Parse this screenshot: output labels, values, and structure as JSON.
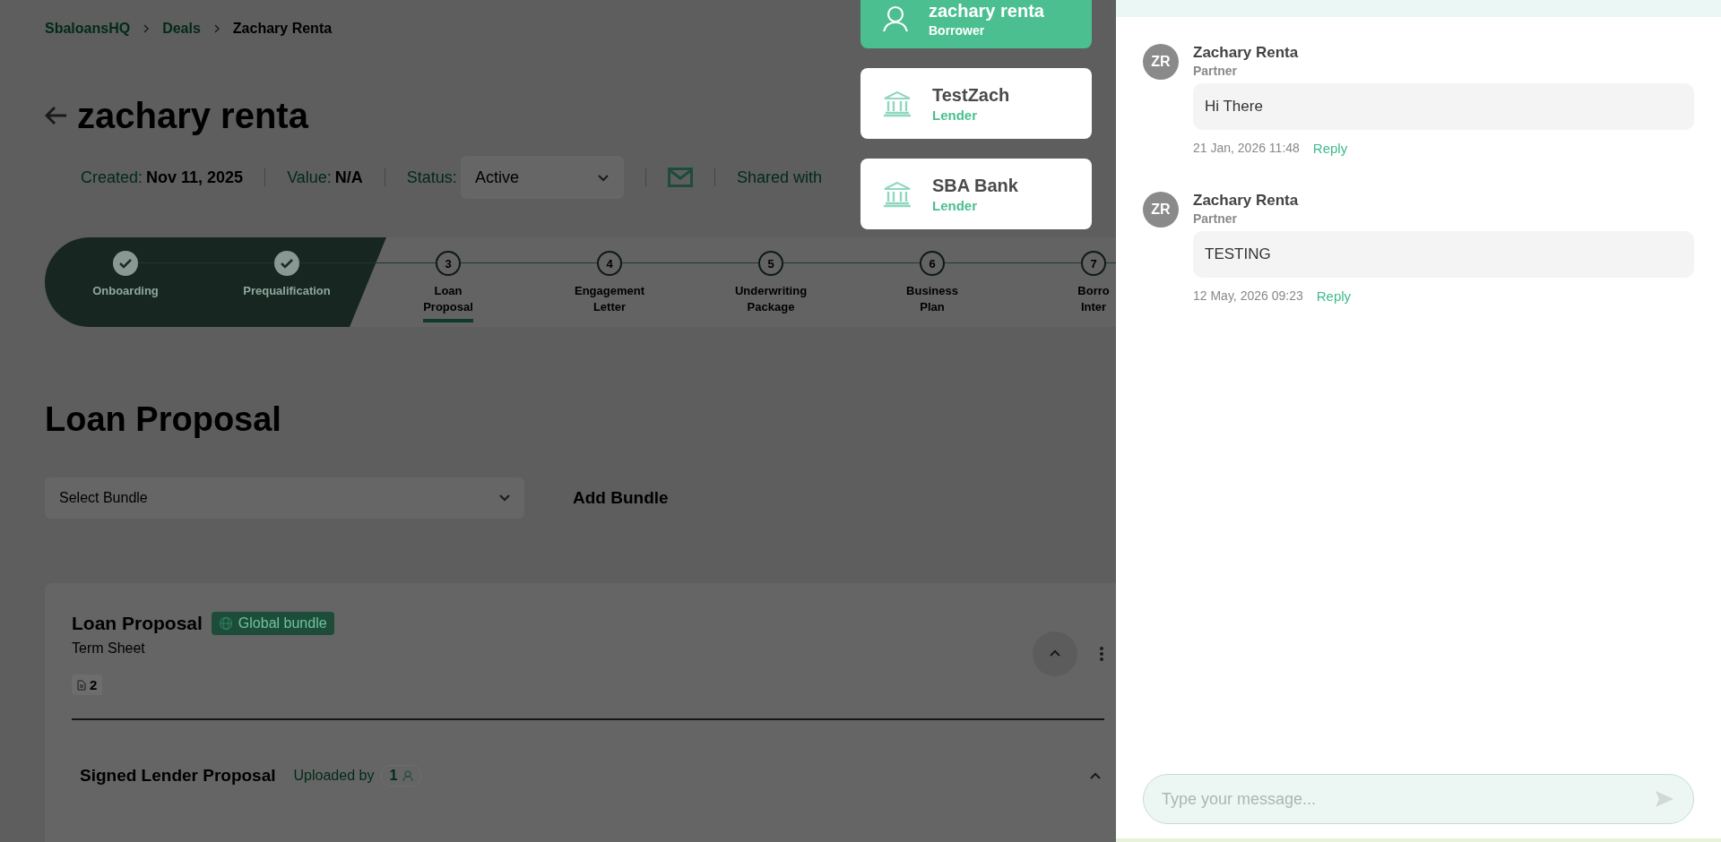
{
  "breadcrumbs": [
    {
      "label": "SbaloansHQ",
      "current": false
    },
    {
      "label": "Deals",
      "current": false
    },
    {
      "label": "Zachary Renta",
      "current": true
    }
  ],
  "deal": {
    "title": "zachary renta",
    "created_label": "Created:",
    "created": "Nov 11, 2025",
    "value_label": "Value:",
    "value": "N/A",
    "status_label": "Status:",
    "status": "Active",
    "shared_label": "Shared with"
  },
  "steps": [
    {
      "label": "Onboarding",
      "completed": true,
      "selected": false
    },
    {
      "label": "Prequalification",
      "completed": true,
      "selected": false
    },
    {
      "number": "3",
      "label": "Loan Proposal",
      "completed": false,
      "selected": true
    },
    {
      "number": "4",
      "label": "Engagement Letter",
      "completed": false,
      "selected": false
    },
    {
      "number": "5",
      "label": "Underwriting Package",
      "completed": false,
      "selected": false
    },
    {
      "number": "6",
      "label": "Business Plan",
      "completed": false,
      "selected": false
    },
    {
      "number": "7",
      "label": "Borro Inter",
      "completed": false,
      "selected": false
    }
  ],
  "section": {
    "title": "Loan Proposal",
    "bundle_select": {
      "placeholder": "Select Bundle"
    },
    "add_bundle": "Add Bundle"
  },
  "bundle": {
    "title": "Loan Proposal",
    "badge": "Global bundle",
    "subtitle": "Term Sheet",
    "doc_count": "2",
    "expanded": true,
    "items": [
      {
        "title": "Signed Lender Proposal",
        "uploaded_label": "Uploaded by",
        "uploader_count": "1",
        "expanded": true
      }
    ]
  },
  "participants": [
    {
      "name": "zachary renta",
      "role": "Borrower",
      "kind": "person",
      "selected": true
    },
    {
      "name": "TestZach",
      "role": "Lender",
      "kind": "bank",
      "selected": false
    },
    {
      "name": "SBA Bank",
      "role": "Lender",
      "kind": "bank",
      "selected": false
    }
  ],
  "comments": [
    {
      "initials": "ZR",
      "author": "Zachary Renta",
      "role": "Partner",
      "text": "Hi There",
      "time": "21 Jan, 2026 11:48",
      "reply": "Reply"
    },
    {
      "initials": "ZR",
      "author": "Zachary Renta",
      "role": "Partner",
      "text": "TESTING",
      "time": "12 May, 2026 09:23",
      "reply": "Reply"
    }
  ],
  "composer": {
    "placeholder": "Type your message..."
  }
}
